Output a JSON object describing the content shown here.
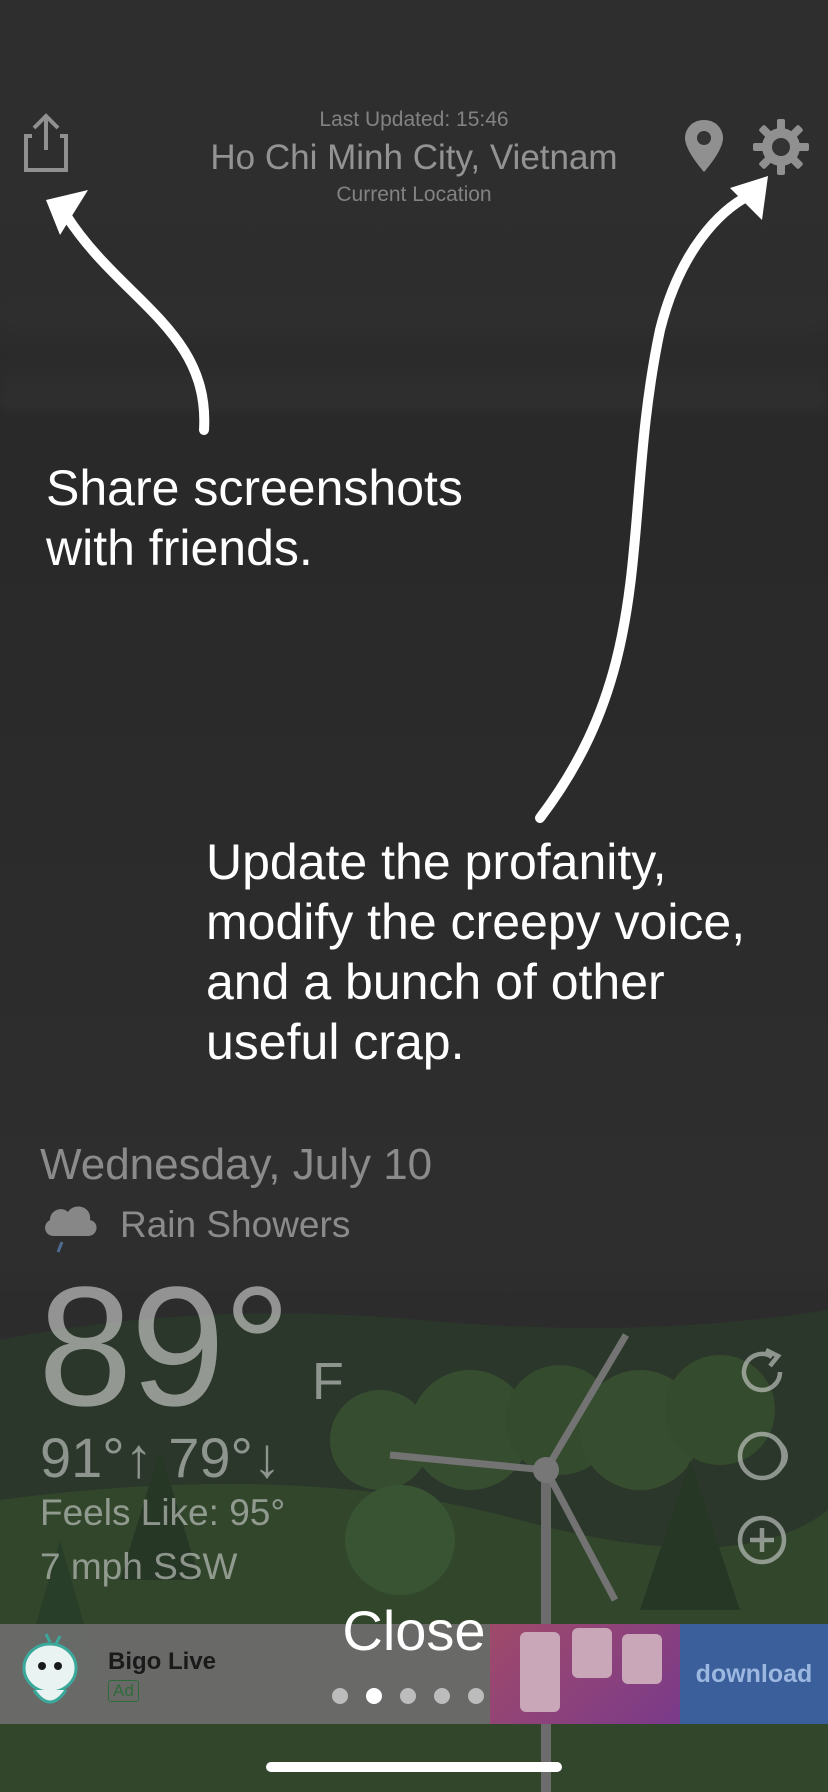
{
  "header": {
    "last_updated": "Last Updated: 15:46",
    "city": "Ho Chi Minh City, Vietnam",
    "location_label": "Current Location"
  },
  "icons": {
    "share": "share-icon",
    "location": "location-pin-icon",
    "settings": "gear-icon",
    "refresh": "refresh-icon",
    "moon": "moon-icon",
    "add": "add-icon",
    "condition": "rain-cloud-icon"
  },
  "weather": {
    "date": "Wednesday, July 10",
    "condition": "Rain Showers",
    "temperature": "89°",
    "unit": "F",
    "high_low": "91°↑ 79°↓",
    "feels_like": "Feels Like: 95°",
    "wind": "7 mph SSW"
  },
  "tutorial": {
    "share_tip_line1": "Share screenshots",
    "share_tip_line2": "with friends.",
    "settings_tip_line1": "Update the profanity,",
    "settings_tip_line2": "modify the creepy voice,",
    "settings_tip_line3": "and a bunch of other",
    "settings_tip_line4": "useful crap.",
    "close_label": "Close",
    "page_count": 5,
    "current_page": 2
  },
  "ad": {
    "title": "Bigo Live",
    "badge": "Ad",
    "cta": "download"
  },
  "colors": {
    "background": "#2b2b2b",
    "ad_cta": "#3a5f9a",
    "ad_badge": "#2f6b3a"
  }
}
